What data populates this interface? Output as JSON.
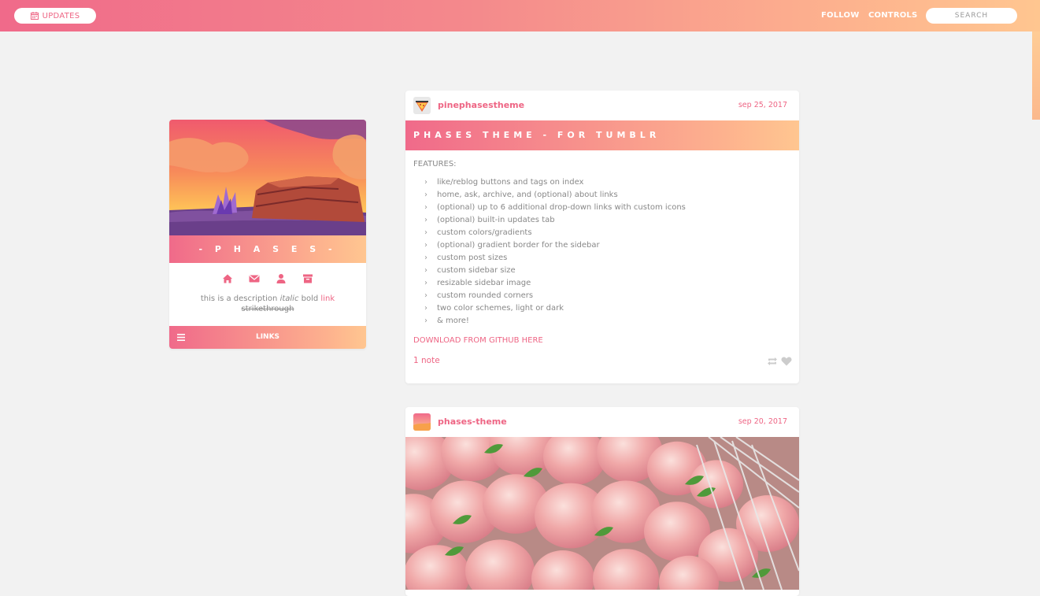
{
  "topbar": {
    "updates_label": "UPDATES",
    "follow_label": "FOLLOW",
    "controls_label": "CONTROLS",
    "search_placeholder": "SEARCH"
  },
  "sidebar": {
    "title": "- P H A S E S -",
    "nav_icons": [
      "home-icon",
      "mail-icon",
      "user-icon",
      "archive-icon"
    ],
    "description": {
      "prefix": "this is a description ",
      "italic": "italic",
      "bold": " bold ",
      "link": "link",
      "strike": "strikethrough"
    },
    "links_label": "LINKS"
  },
  "posts": [
    {
      "username": "pinephasestheme",
      "date": "sep 25, 2017",
      "title": "PHASES THEME - FOR TUMBLR",
      "features_label": "FEATURES:",
      "features": [
        "like/reblog buttons and tags on index",
        "home, ask, archive, and (optional) about links",
        "(optional) up to 6 additional drop-down links with custom icons",
        "(optional) built-in updates tab",
        "custom colors/gradients",
        "(optional) gradient border for the sidebar",
        "custom post sizes",
        "custom sidebar size",
        "resizable sidebar image",
        "custom rounded corners",
        "two color schemes, light or dark",
        "& more!"
      ],
      "download_link": "DOWNLOAD FROM GITHUB HERE",
      "notes": "1 note"
    },
    {
      "username": "phases-theme",
      "date": "sep 20, 2017"
    }
  ],
  "colors": {
    "accent": "#ee6584",
    "gradient_start": "#f06a8a",
    "gradient_end": "#ffc690",
    "background": "#f2f2f2"
  }
}
